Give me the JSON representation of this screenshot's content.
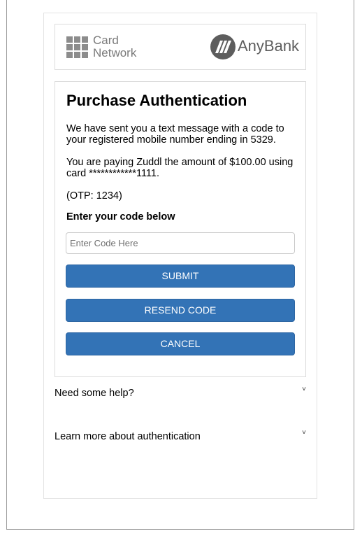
{
  "logos": {
    "card_network_line1": "Card",
    "card_network_line2": "Network",
    "bank_name": "AnyBank"
  },
  "auth": {
    "title": "Purchase Authentication",
    "message_sent": "We have sent you a text message with a code to your registered mobile number ending in 5329.",
    "paying": "You are paying Zuddl the amount of $100.00 using card ************1111.",
    "otp_hint": "(OTP: 1234)",
    "code_label": "Enter your code below",
    "code_placeholder": "Enter Code Here",
    "code_value": "",
    "submit_label": "SUBMIT",
    "resend_label": "RESEND CODE",
    "cancel_label": "CANCEL"
  },
  "help": {
    "need_help": "Need some help?",
    "learn_more": "Learn more about authentication",
    "chevron": "˅"
  },
  "colors": {
    "button_blue": "#3373b6",
    "logo_gray": "#5d5d5d"
  }
}
